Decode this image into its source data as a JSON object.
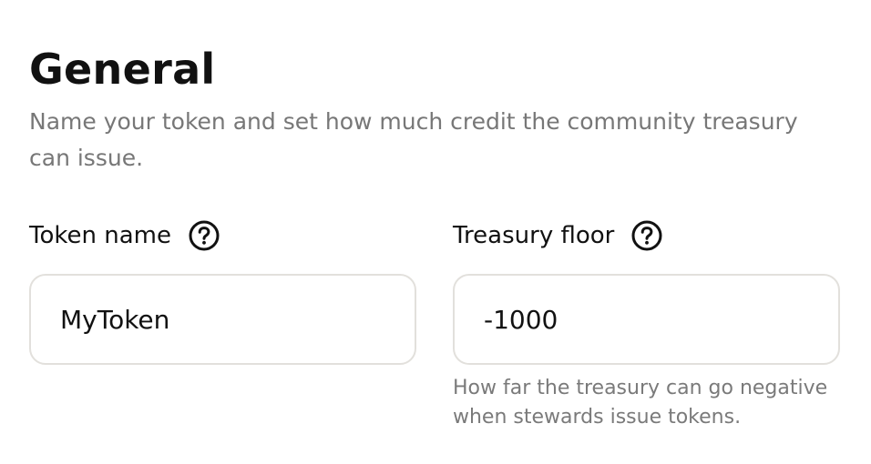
{
  "section": {
    "title": "General",
    "subtitle": "Name your token and set how much credit the community treasury can issue."
  },
  "fields": {
    "token_name": {
      "label": "Token name",
      "value": "MyToken",
      "help_icon": "question-circle-icon"
    },
    "treasury_floor": {
      "label": "Treasury floor",
      "value": "-1000",
      "help_icon": "question-circle-icon",
      "hint": "How far the treasury can go negative when stewards issue tokens."
    }
  },
  "colors": {
    "heading": "#111111",
    "muted_text": "#777777",
    "input_border": "#e2e0dc"
  }
}
